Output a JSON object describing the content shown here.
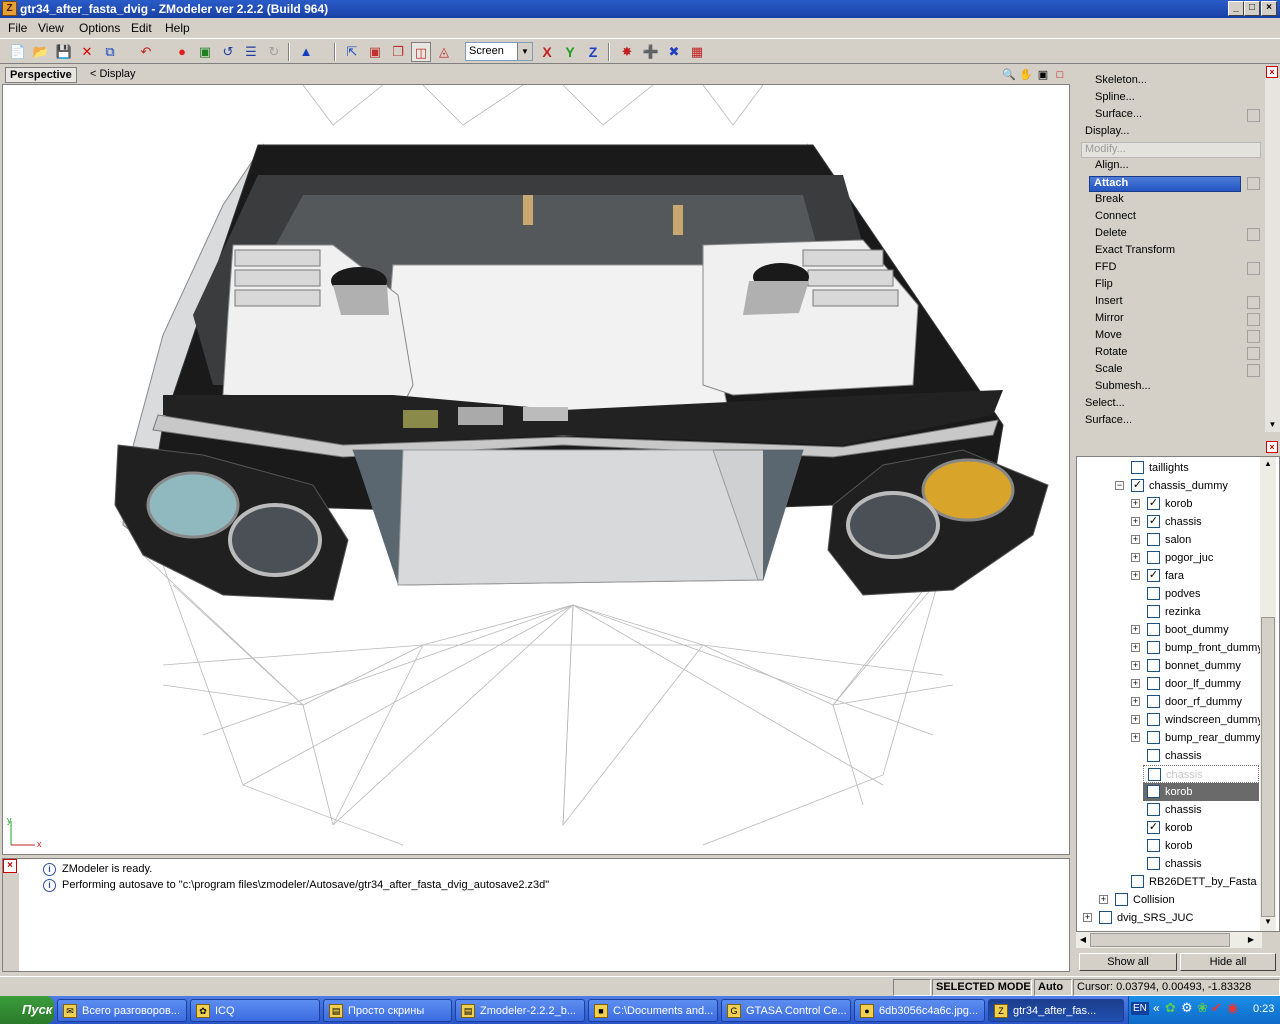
{
  "window": {
    "title": "gtr34_after_fasta_dvig - ZModeler ver 2.2.2 (Build 964)",
    "app_icon": "Z",
    "controls": [
      "_",
      "□",
      "×"
    ]
  },
  "menu": [
    {
      "label": "File"
    },
    {
      "label": "View"
    },
    {
      "label": "Options"
    },
    {
      "label": "Edit"
    },
    {
      "label": "Help"
    }
  ],
  "toolbar": {
    "buttons": [
      "new-file-icon",
      "open-folder-icon",
      "save-icon",
      "delete-icon",
      "copy-icon",
      "undo-icon",
      "record-icon",
      "render-icon",
      "rotate-icon",
      "list-icon",
      "redo-icon",
      "vertex-select-icon",
      "face-select-icon",
      "box-select-icon",
      "object-select-icon",
      "mesh-select-icon",
      "cube-select-icon"
    ],
    "screen_select": "Screen",
    "axis_x": "X",
    "axis_y": "Y",
    "axis_z": "Z"
  },
  "viewport": {
    "tab": "Perspective",
    "display_label": "< Display",
    "axis_y_label": "y",
    "axis_x_label": "x"
  },
  "log": {
    "lines": [
      "ZModeler is ready.",
      "Performing autosave to \"c:\\program files\\zmodeler/Autosave/gtr34_after_fasta_dvig_autosave2.z3d\""
    ]
  },
  "tools_panel": {
    "items": [
      {
        "label": "Skeleton...",
        "indent": 1,
        "check": false
      },
      {
        "label": "Spline...",
        "indent": 1,
        "check": false
      },
      {
        "label": "Surface...",
        "indent": 1,
        "check": true
      },
      {
        "label": "Display...",
        "indent": 0,
        "check": false
      },
      {
        "label": "Modify...",
        "indent": 0,
        "check": false,
        "disabled": true
      },
      {
        "label": "Align...",
        "indent": 1,
        "check": false
      },
      {
        "label": "Attach",
        "indent": 1,
        "check": true,
        "selected": true
      },
      {
        "label": "Break",
        "indent": 1,
        "check": false
      },
      {
        "label": "Connect",
        "indent": 1,
        "check": false
      },
      {
        "label": "Delete",
        "indent": 1,
        "check": true
      },
      {
        "label": "Exact Transform",
        "indent": 1,
        "check": false
      },
      {
        "label": "FFD",
        "indent": 1,
        "check": true
      },
      {
        "label": "Flip",
        "indent": 1,
        "check": false
      },
      {
        "label": "Insert",
        "indent": 1,
        "check": true
      },
      {
        "label": "Mirror",
        "indent": 1,
        "check": true
      },
      {
        "label": "Move",
        "indent": 1,
        "check": true
      },
      {
        "label": "Rotate",
        "indent": 1,
        "check": true
      },
      {
        "label": "Scale",
        "indent": 1,
        "check": true
      },
      {
        "label": "Submesh...",
        "indent": 1,
        "check": false
      },
      {
        "label": "Select...",
        "indent": 0,
        "check": false
      },
      {
        "label": "Surface...",
        "indent": 0,
        "check": false
      }
    ]
  },
  "tree": {
    "rows": [
      {
        "label": "taillights",
        "level": 2,
        "expander": "",
        "checked": false
      },
      {
        "label": "chassis_dummy",
        "level": 2,
        "expander": "-",
        "checked": true
      },
      {
        "label": "korob",
        "level": 3,
        "expander": "+",
        "checked": true
      },
      {
        "label": "chassis",
        "level": 3,
        "expander": "+",
        "checked": true
      },
      {
        "label": "salon",
        "level": 3,
        "expander": "+",
        "checked": false
      },
      {
        "label": "pogor_juc",
        "level": 3,
        "expander": "+",
        "checked": false
      },
      {
        "label": "fara",
        "level": 3,
        "expander": "+",
        "checked": true
      },
      {
        "label": "podves",
        "level": 3,
        "expander": "",
        "checked": false
      },
      {
        "label": "rezinka",
        "level": 3,
        "expander": "",
        "checked": false
      },
      {
        "label": "boot_dummy",
        "level": 3,
        "expander": "+",
        "checked": false
      },
      {
        "label": "bump_front_dummy",
        "level": 3,
        "expander": "+",
        "checked": false
      },
      {
        "label": "bonnet_dummy",
        "level": 3,
        "expander": "+",
        "checked": false
      },
      {
        "label": "door_lf_dummy",
        "level": 3,
        "expander": "+",
        "checked": false
      },
      {
        "label": "door_rf_dummy",
        "level": 3,
        "expander": "+",
        "checked": false
      },
      {
        "label": "windscreen_dummy",
        "level": 3,
        "expander": "+",
        "checked": false
      },
      {
        "label": "bump_rear_dummy",
        "level": 3,
        "expander": "+",
        "checked": false
      },
      {
        "label": "chassis",
        "level": 3,
        "expander": "",
        "checked": false
      },
      {
        "label": "chassis",
        "level": 3,
        "expander": "",
        "checked": false,
        "ghost": true
      },
      {
        "label": "korob",
        "level": 3,
        "expander": "",
        "checked": false,
        "selected": true
      },
      {
        "label": "chassis",
        "level": 3,
        "expander": "",
        "checked": false
      },
      {
        "label": "korob",
        "level": 3,
        "expander": "",
        "checked": true
      },
      {
        "label": "korob",
        "level": 3,
        "expander": "",
        "checked": false
      },
      {
        "label": "chassis",
        "level": 3,
        "expander": "",
        "checked": false
      },
      {
        "label": "RB26DETT_by_Fasta",
        "level": 2,
        "expander": "",
        "checked": false
      },
      {
        "label": "Collision",
        "level": 1,
        "expander": "+",
        "checked": false
      },
      {
        "label": "dvig_SRS_JUC",
        "level": 0,
        "expander": "+",
        "checked": false
      }
    ],
    "show_all": "Show all",
    "hide_all": "Hide all"
  },
  "status": {
    "mode": "SELECTED MODE",
    "auto": "Auto",
    "cursor": "Cursor: 0.03794, 0.00493, -1.83328"
  },
  "taskbar": {
    "start": "Пуск",
    "tasks": [
      {
        "label": "Всего разговоров...",
        "icon": "chat-icon"
      },
      {
        "label": "ICQ",
        "icon": "icq-icon"
      },
      {
        "label": "Просто скрины",
        "icon": "folder-icon"
      },
      {
        "label": "Zmodeler-2.2.2_b...",
        "icon": "folder-icon"
      },
      {
        "label": "C:\\Documents and...",
        "icon": "console-icon"
      },
      {
        "label": "GTASA Control Ce...",
        "icon": "gtasa-icon"
      },
      {
        "label": "6db3056c4a6c.jpg...",
        "icon": "firefox-icon"
      },
      {
        "label": "gtr34_after_fas...",
        "icon": "zmodeler-icon",
        "active": true
      }
    ],
    "lang": "EN",
    "time": "0:23"
  }
}
